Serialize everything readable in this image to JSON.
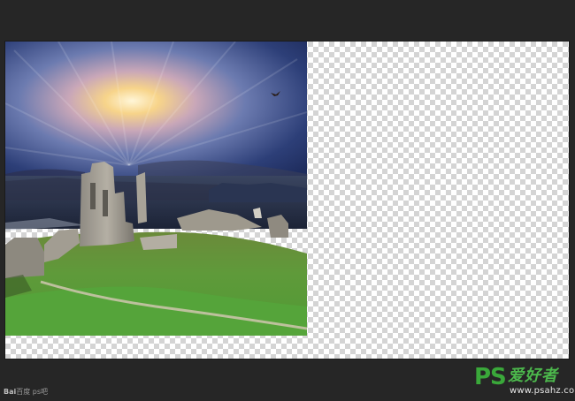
{
  "watermark": {
    "baidu_text": "Bai",
    "baidu_suffix": "百度",
    "source": "ps吧"
  },
  "logo": {
    "ps": "PS",
    "chinese": "爱好者",
    "url": "www.psahz.com"
  },
  "colors": {
    "workspace_bg": "#262626",
    "logo_green": "#3aa83a",
    "transparency_check": "#d4d4d4"
  }
}
